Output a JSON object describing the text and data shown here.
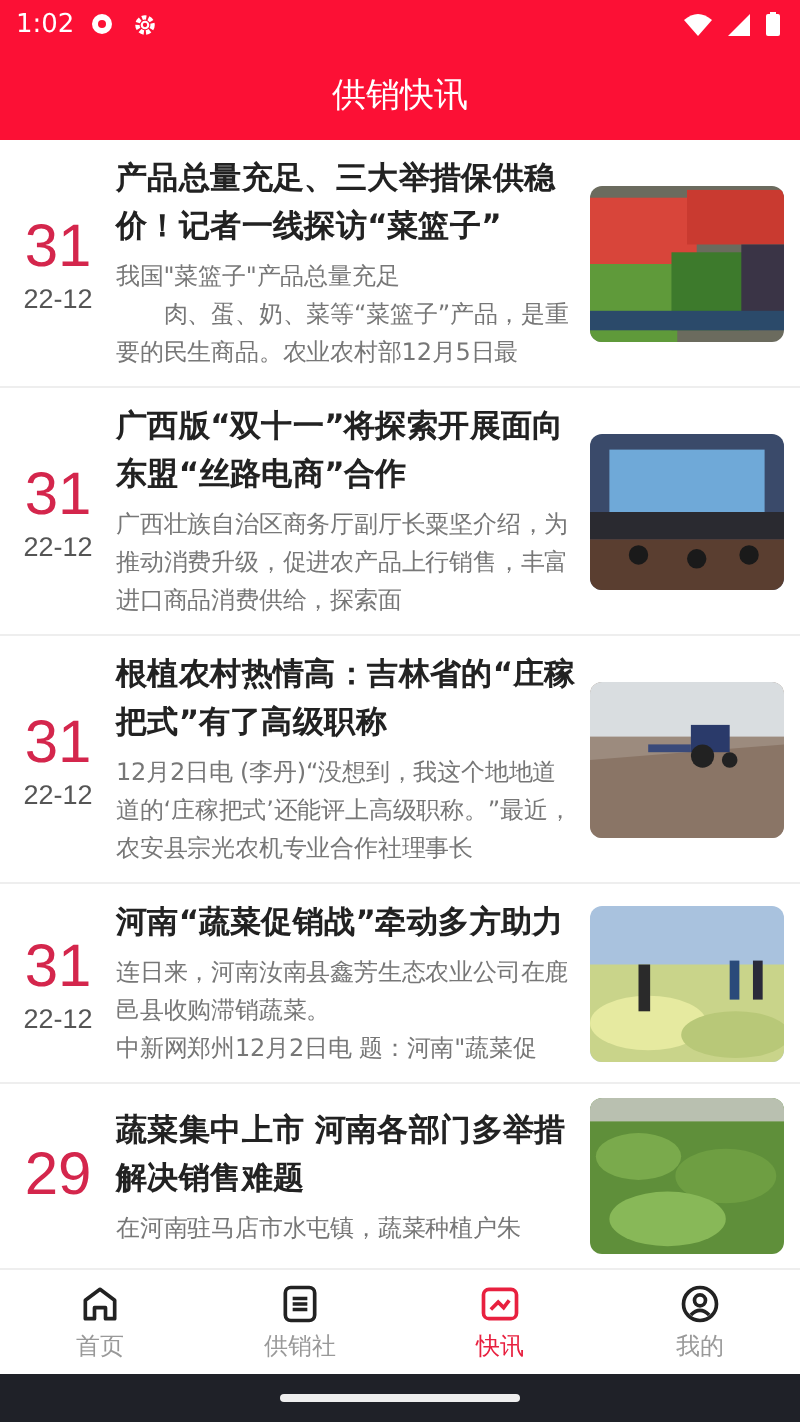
{
  "status_bar": {
    "time": "1:02"
  },
  "header": {
    "title": "供销快讯"
  },
  "news": [
    {
      "day": "31",
      "date": "22-12",
      "title": "产品总量充足、三大举措保供稳价！记者一线探访“菜篮子”",
      "summary": [
        "我国\"菜篮子\"产品总量充足",
        "　　肉、蛋、奶、菜等“菜篮子”产品，是重要的民生商品。农业农村部12月5日最"
      ],
      "picture": {
        "kind": "picture"
      }
    },
    {
      "day": "31",
      "date": "22-12",
      "title": "广西版“双十一”将探索开展面向东盟“丝路电商”合作",
      "summary": [
        "广西壮族自治区商务厅副厅长粟坚介绍，为推动消费升级，促进农产品上行销售，丰富进口商品消费供给，探索面"
      ],
      "picture": {
        "kind": "picture"
      }
    },
    {
      "day": "31",
      "date": "22-12",
      "title": "根植农村热情高：吉林省的“庄稼把式”有了高级职称",
      "summary": [
        "12月2日电 (李丹)“没想到，我这个地地道道的‘庄稼把式’还能评上高级职称。”最近，农安县宗光农机专业合作社理事长"
      ],
      "picture": {
        "kind": "picture"
      }
    },
    {
      "day": "31",
      "date": "22-12",
      "title": "河南“蔬菜促销战”牵动多方助力",
      "summary": [
        "连日来，河南汝南县鑫芳生态农业公司在鹿邑县收购滞销蔬菜。",
        "中新网郑州12月2日电 题：河南\"蔬菜促"
      ],
      "picture": {
        "kind": "picture"
      }
    },
    {
      "day": "29",
      "title": "蔬菜集中上市 河南各部门多举措解决销售难题",
      "summary": [
        "在河南驻马店市水屯镇，蔬菜种植户朱"
      ],
      "picture": {
        "kind": "picture"
      }
    }
  ],
  "tabs": [
    {
      "label": "首页",
      "selected": false
    },
    {
      "label": "供销社",
      "selected": false
    },
    {
      "label": "快讯",
      "selected": true
    },
    {
      "label": "我的",
      "selected": false
    }
  ]
}
